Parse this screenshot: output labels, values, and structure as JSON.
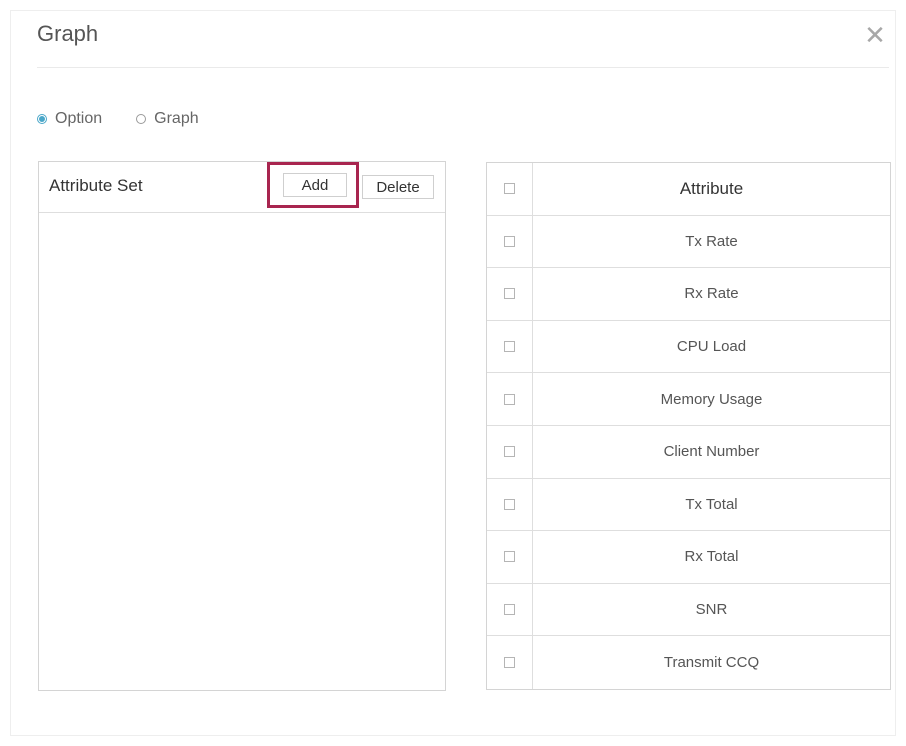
{
  "dialog": {
    "title": "Graph",
    "close_icon": "close-icon"
  },
  "mode": {
    "options": [
      {
        "label": "Option",
        "checked": true
      },
      {
        "label": "Graph",
        "checked": false
      }
    ]
  },
  "attribute_set": {
    "title": "Attribute Set",
    "add_label": "Add",
    "delete_label": "Delete",
    "items": []
  },
  "attributes": {
    "header": "Attribute",
    "rows": [
      {
        "name": "Tx Rate",
        "checked": false
      },
      {
        "name": "Rx Rate",
        "checked": false
      },
      {
        "name": "CPU Load",
        "checked": false
      },
      {
        "name": "Memory Usage",
        "checked": false
      },
      {
        "name": "Client Number",
        "checked": false
      },
      {
        "name": "Tx Total",
        "checked": false
      },
      {
        "name": "Rx Total",
        "checked": false
      },
      {
        "name": "SNR",
        "checked": false
      },
      {
        "name": "Transmit CCQ",
        "checked": false
      }
    ]
  },
  "colors": {
    "accent": "#4aa7c9",
    "highlight_border": "#a8254f"
  }
}
